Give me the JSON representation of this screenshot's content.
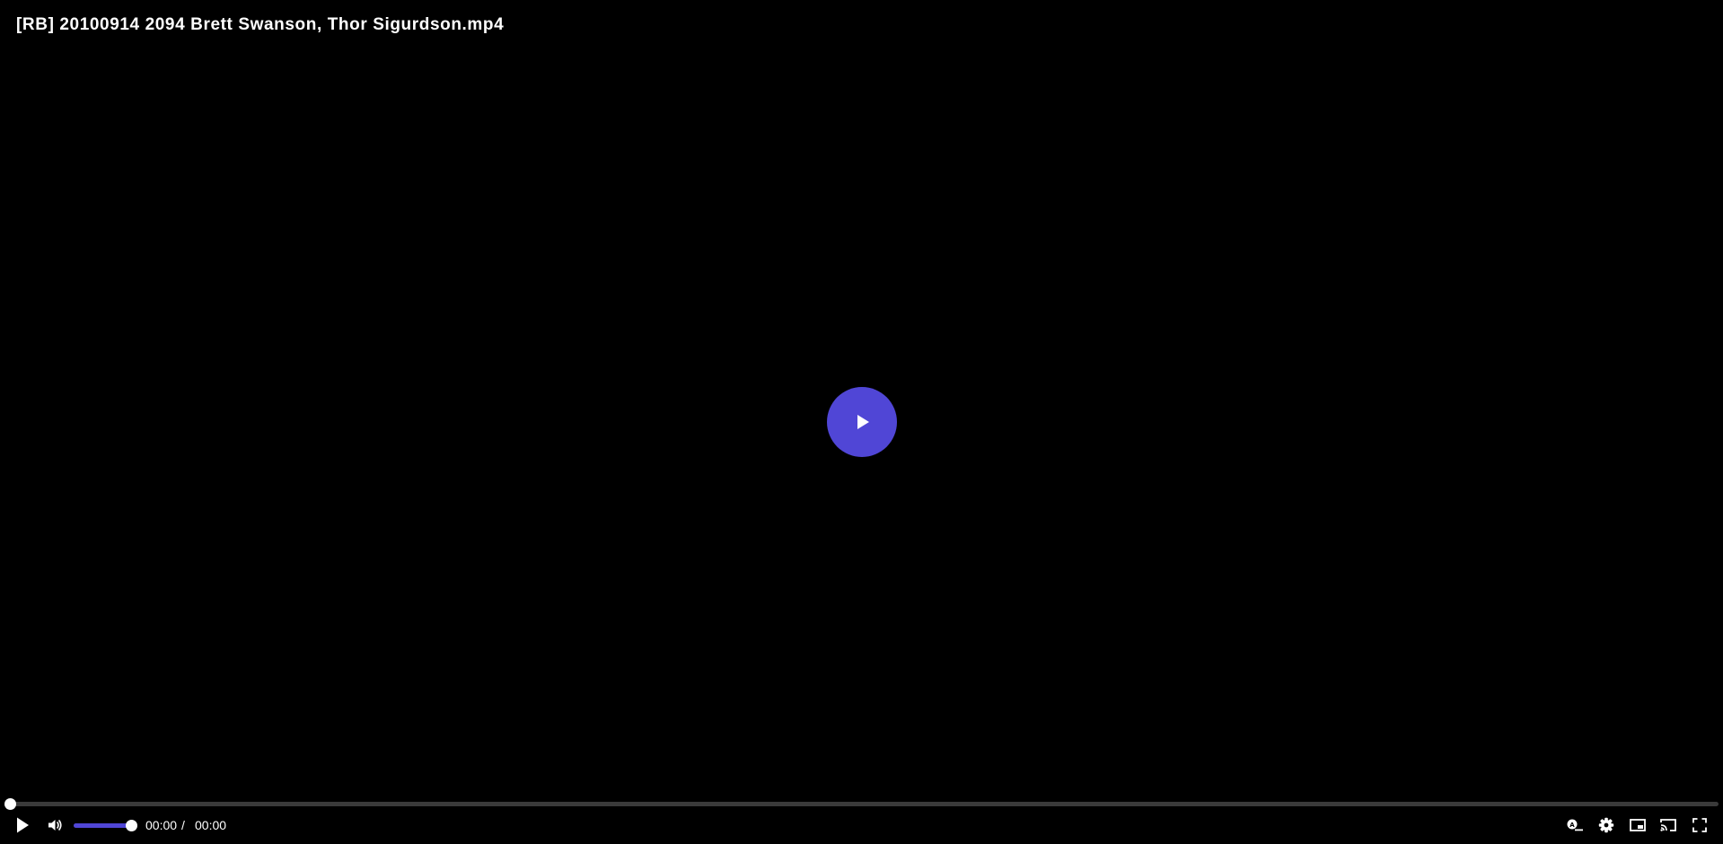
{
  "video": {
    "title": "[RB] 20100914 2094 Brett Swanson, Thor Sigurdson.mp4"
  },
  "playback": {
    "current_time": "00:00",
    "separator": "/",
    "duration": "00:00",
    "progress_fraction": 0,
    "volume_fraction": 1
  },
  "colors": {
    "accent": "#5046d6",
    "background": "#000000",
    "track": "#3a3a3a",
    "foreground": "#ffffff"
  },
  "icons": {
    "big_play": "play-icon",
    "play": "play-icon",
    "volume": "volume-icon",
    "captions": "captions-icon",
    "settings": "gear-icon",
    "pip": "picture-in-picture-icon",
    "cast": "cast-icon",
    "fullscreen": "fullscreen-icon"
  }
}
